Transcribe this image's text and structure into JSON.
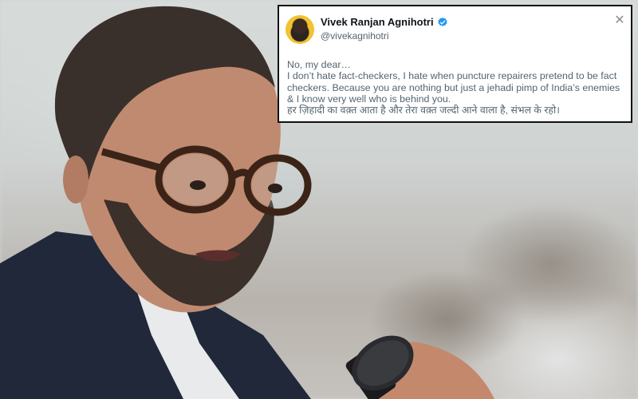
{
  "tweet": {
    "author_name": "Vivek Ranjan Agnihotri",
    "author_handle": "@vivekagnihotri",
    "verified": true,
    "lines": [
      "No, my dear…",
      "I don’t hate fact-checkers, I hate when puncture repairers pretend to be fact checkers. Because you are nothing but just a jehadi pimp of India’s enemies & I know very well who is behind you.",
      "हर ज़िहादी का वक़्त आता है और तेरा वक़्त जल्दी आने वाला है, संभल के रहो।"
    ]
  },
  "colors": {
    "verified_badge": "#1d9bf0",
    "card_border": "#111111",
    "name_text": "#0f1419",
    "secondary_text": "#536471"
  },
  "icons": [
    "verified-badge-icon",
    "close-icon",
    "avatar"
  ]
}
